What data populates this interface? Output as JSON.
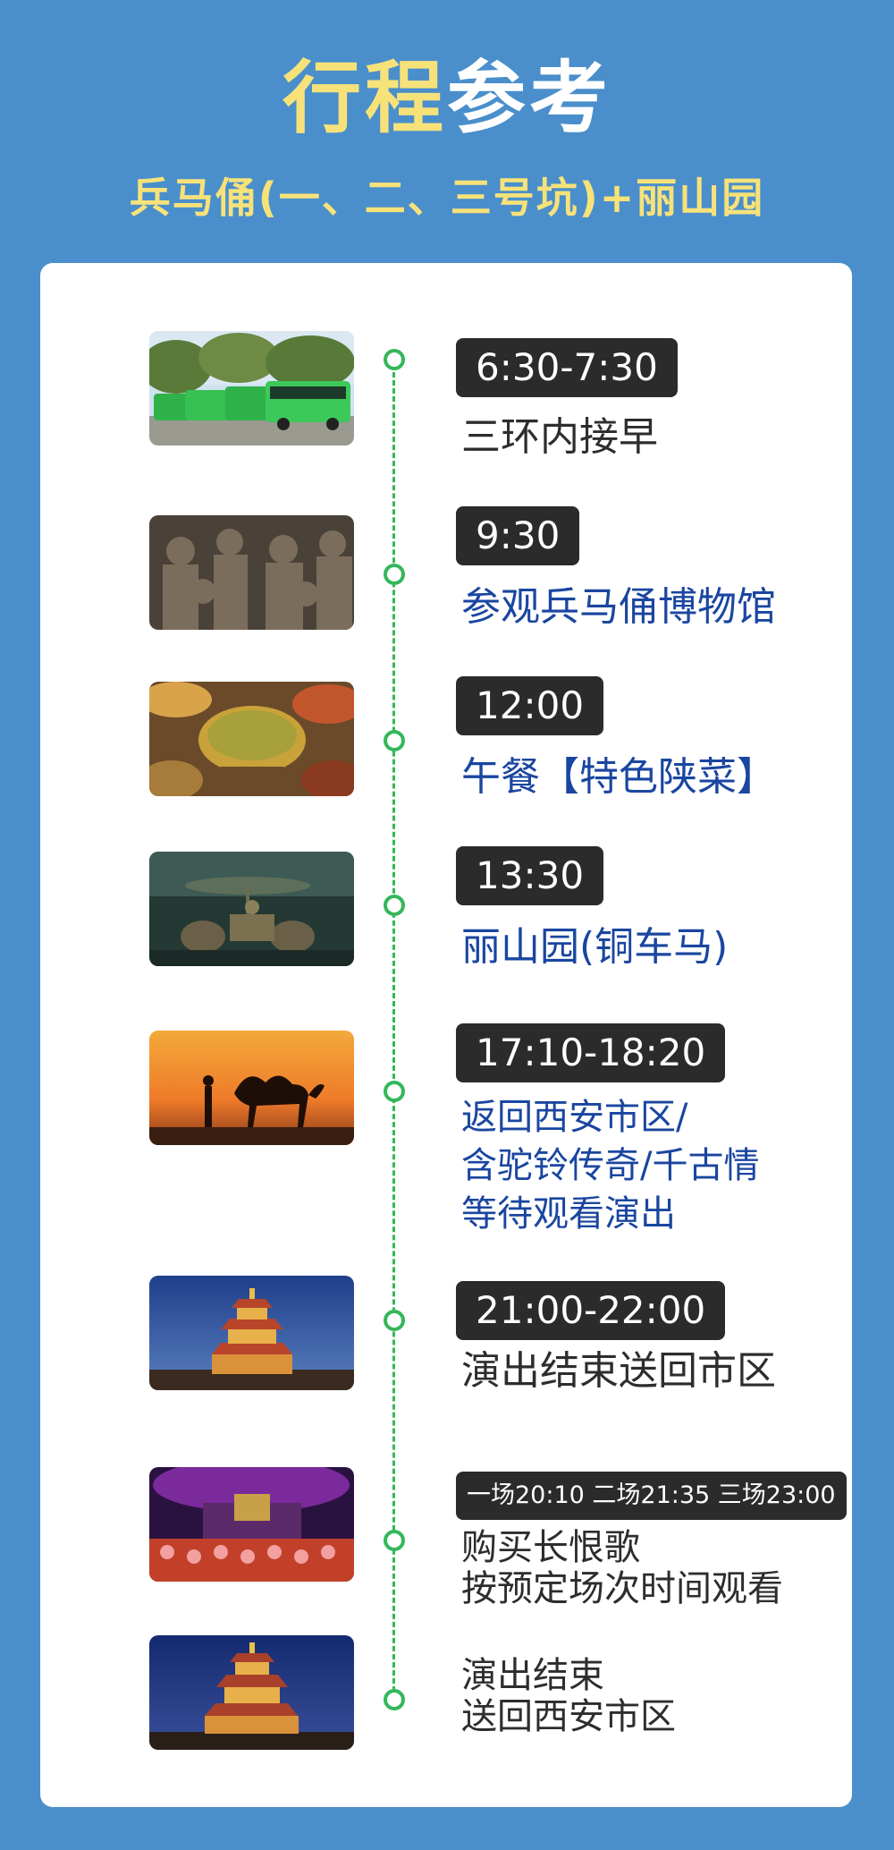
{
  "header": {
    "title_part1": "行程",
    "title_part2": "参考",
    "subtitle": "兵马俑(一、二、三号坑)+丽山园"
  },
  "colors": {
    "background": "#4a8fcb",
    "title_yellow": "#f7e27a",
    "timeline_green": "#35b75a",
    "badge_dark": "#2b2b2b",
    "text_blue": "#1a46a0"
  },
  "itinerary": [
    {
      "time": "6:30-7:30",
      "lines": [
        "三环内接早"
      ],
      "image": "green-buses"
    },
    {
      "time": "9:30",
      "lines": [
        "参观兵马俑博物馆"
      ],
      "image": "terracotta-warriors"
    },
    {
      "time": "12:00",
      "lines": [
        "午餐【特色陕菜】"
      ],
      "image": "shaanxi-dishes"
    },
    {
      "time": "13:30",
      "lines": [
        "丽山园(铜车马)"
      ],
      "image": "bronze-chariot"
    },
    {
      "time": "17:10-18:20",
      "lines": [
        "返回西安市区/",
        "含驼铃传奇/千古情",
        "等待观看演出"
      ],
      "image": "camel-sunset"
    },
    {
      "time": "21:00-22:00",
      "lines": [
        "演出结束送回市区"
      ],
      "image": "bell-tower-night"
    },
    {
      "time": "一场20:10 二场21:35 三场23:00",
      "lines": [
        "购买长恨歌",
        "按预定场次时间观看"
      ],
      "image": "everlasting-regret-show"
    },
    {
      "time": "",
      "lines": [
        "演出结束",
        "送回西安市区"
      ],
      "image": "bell-tower-night"
    }
  ]
}
